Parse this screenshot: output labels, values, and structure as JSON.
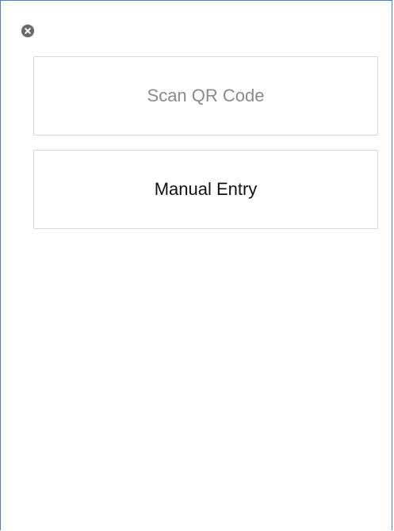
{
  "dialog": {
    "close_icon": "close-circle-icon",
    "options": {
      "scan_label": "Scan QR Code",
      "manual_label": "Manual Entry"
    }
  },
  "colors": {
    "frame_border": "#4a7fd6",
    "button_border": "#d8d8d8",
    "scan_text": "#8a8a8a",
    "manual_text": "#111111",
    "close_icon_bg": "#6b6b6b"
  }
}
